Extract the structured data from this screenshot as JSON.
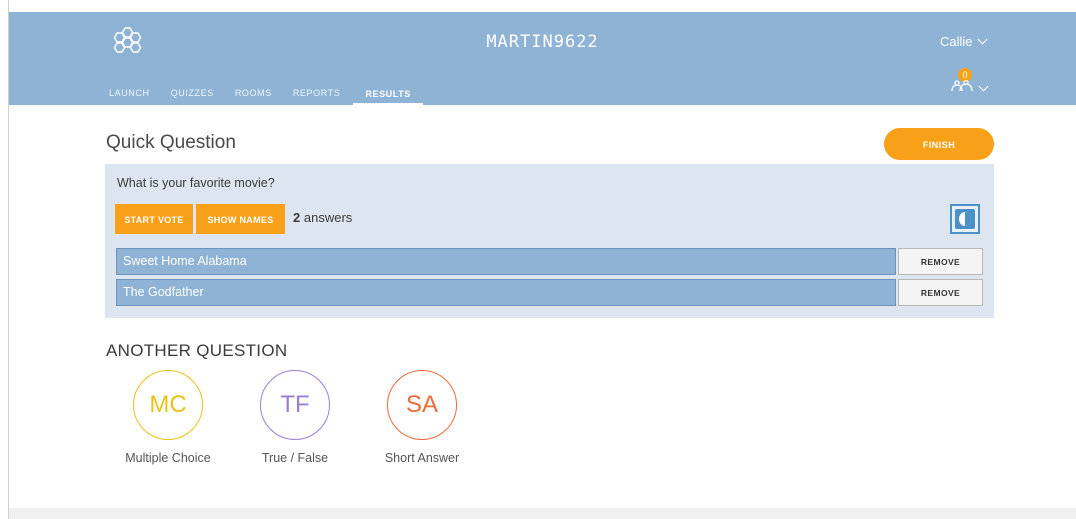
{
  "header": {
    "room_name": "MARTIN9622",
    "user_name": "Callie",
    "notification_count": "0",
    "nav": [
      {
        "label": "LAUNCH"
      },
      {
        "label": "QUIZZES"
      },
      {
        "label": "ROOMS"
      },
      {
        "label": "REPORTS"
      },
      {
        "label": "RESULTS",
        "active": true
      }
    ]
  },
  "main": {
    "title": "Quick Question",
    "finish_label": "FINISH",
    "question": "What is your favorite movie?",
    "start_vote_label": "START VOTE",
    "show_names_label": "SHOW NAMES",
    "answers_count": "2",
    "answers_suffix": "answers",
    "answers": [
      {
        "text": "Sweet Home Alabama",
        "remove_label": "REMOVE"
      },
      {
        "text": "The Godfather",
        "remove_label": "REMOVE"
      }
    ]
  },
  "another_question": {
    "heading": "ANOTHER QUESTION",
    "types": [
      {
        "abbr": "MC",
        "label": "Multiple Choice",
        "color": "#e8c21a"
      },
      {
        "abbr": "TF",
        "label": "True / False",
        "color": "#9b7fcf"
      },
      {
        "abbr": "SA",
        "label": "Short Answer",
        "color": "#ee6a3b"
      }
    ]
  },
  "colors": {
    "header_bg": "#8fb3d4",
    "accent_orange": "#f8a018",
    "panel_bg": "#dde6f0",
    "answer_bar": "#8fb3d4",
    "toggle_blue": "#4a90c9"
  }
}
